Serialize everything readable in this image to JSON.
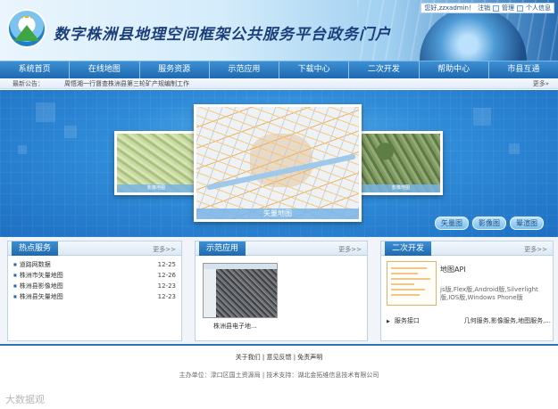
{
  "header": {
    "site_title": "数字株洲县地理空间框架公共服务平台政务门户",
    "greeting": "您好,zzxadmin！",
    "logout": "注销",
    "manage": "管理",
    "profile": "个人信息"
  },
  "nav": {
    "items": [
      "系统首页",
      "在线地图",
      "服务资源",
      "示范应用",
      "下载中心",
      "二次开发",
      "帮助中心",
      "市县互通"
    ]
  },
  "notice": {
    "label": "最新公告：",
    "text": "周悟湘一行督查株洲县第三轮矿产规编制工作",
    "more": "更多»"
  },
  "banner": {
    "center_caption": "矢量地图",
    "left_caption": "影像地图",
    "right_caption": "影像地图",
    "buttons": [
      "矢量图",
      "影像图",
      "晕渲图"
    ]
  },
  "hot": {
    "title": "热点服务",
    "more": "更多>>",
    "items": [
      {
        "name": "道路网数据",
        "date": "12-25"
      },
      {
        "name": "株洲市矢量地图",
        "date": "12-26"
      },
      {
        "name": "株洲县影像地图",
        "date": "12-23"
      },
      {
        "name": "株洲县矢量地图",
        "date": "12-23"
      }
    ]
  },
  "demo": {
    "title": "示范应用",
    "more": "更多>>",
    "caption": "株洲县电子地..."
  },
  "dev": {
    "title": "二次开发",
    "more": "更多>>",
    "api_title": "地图API",
    "api_desc": "js版,Flex版,Android版,Silverlight版,IOS版,Windows Phone版",
    "row_key": "服务接口",
    "row_val": "几何服务,影像服务,地图服务,..."
  },
  "footer": {
    "links": "关于我们 | 意见反馈 | 免责声明",
    "info": "主办单位：渌口区国土资源局 | 技术支持：湖北金拓维信息技术有限公司"
  },
  "watermark": "大数据观",
  "colors": {
    "nav_blue": "#1e69b1",
    "accent_blue": "#2a74bb",
    "banner_blue": "#2f8bd8"
  }
}
